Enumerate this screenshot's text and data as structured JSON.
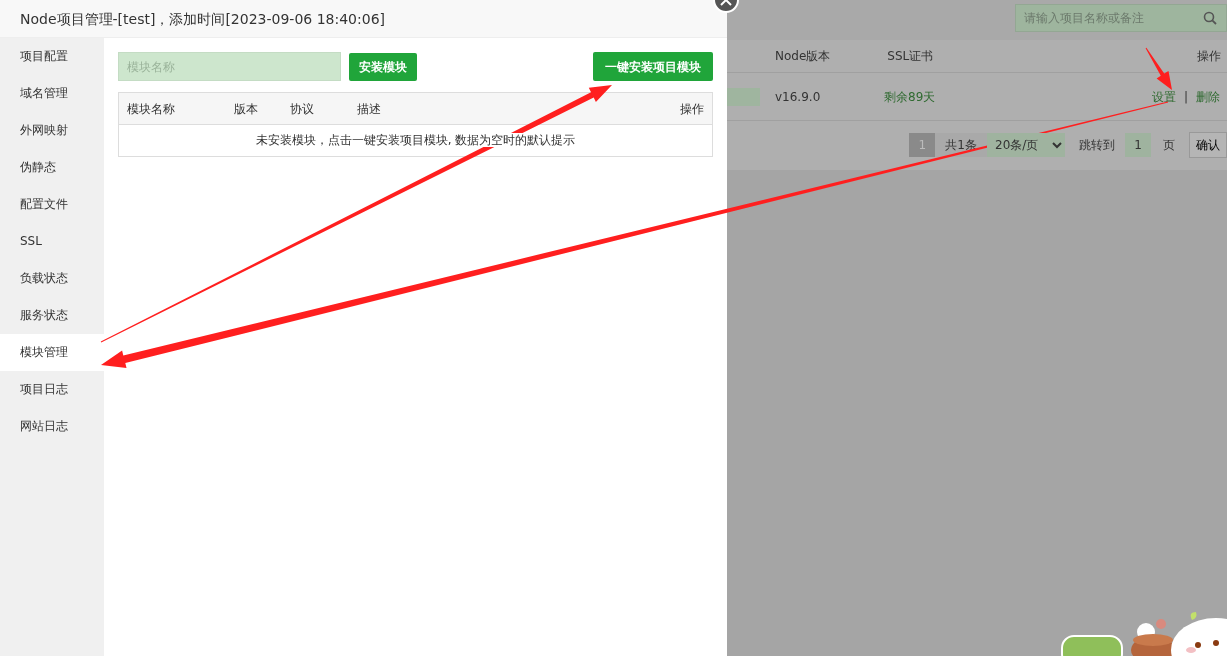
{
  "modal": {
    "title": "Node项目管理-[test]，添加时间[2023-09-06 18:40:06]",
    "sidebar": [
      {
        "label": "项目配置",
        "selected": false
      },
      {
        "label": "域名管理",
        "selected": false
      },
      {
        "label": "外网映射",
        "selected": false
      },
      {
        "label": "伪静态",
        "selected": false
      },
      {
        "label": "配置文件",
        "selected": false
      },
      {
        "label": "SSL",
        "selected": false
      },
      {
        "label": "负载状态",
        "selected": false
      },
      {
        "label": "服务状态",
        "selected": false
      },
      {
        "label": "模块管理",
        "selected": true
      },
      {
        "label": "项目日志",
        "selected": false
      },
      {
        "label": "网站日志",
        "selected": false
      }
    ],
    "module_input": {
      "placeholder": "模块名称"
    },
    "install_button": "安装模块",
    "install_all_button": "一键安装项目模块",
    "table": {
      "columns": [
        "模块名称",
        "版本",
        "协议",
        "描述",
        "操作"
      ],
      "empty_text": "未安装模块，点击一键安装项目模块, 数据为空时的默认提示"
    }
  },
  "background": {
    "search": {
      "placeholder": "请输入项目名称或备注"
    },
    "table": {
      "columns": [
        "Node版本",
        "SSL证书",
        "操作"
      ],
      "rows": [
        {
          "node_version": "v16.9.0",
          "ssl": "剩余89天",
          "actions": [
            "设置",
            "删除"
          ],
          "action_separator": "|"
        }
      ]
    },
    "pagination": {
      "current": "1",
      "total": "共1条",
      "page_size": "20条/页",
      "jump_label": "跳转到",
      "jump_value": "1",
      "page_unit": "页",
      "confirm": "确认"
    }
  }
}
